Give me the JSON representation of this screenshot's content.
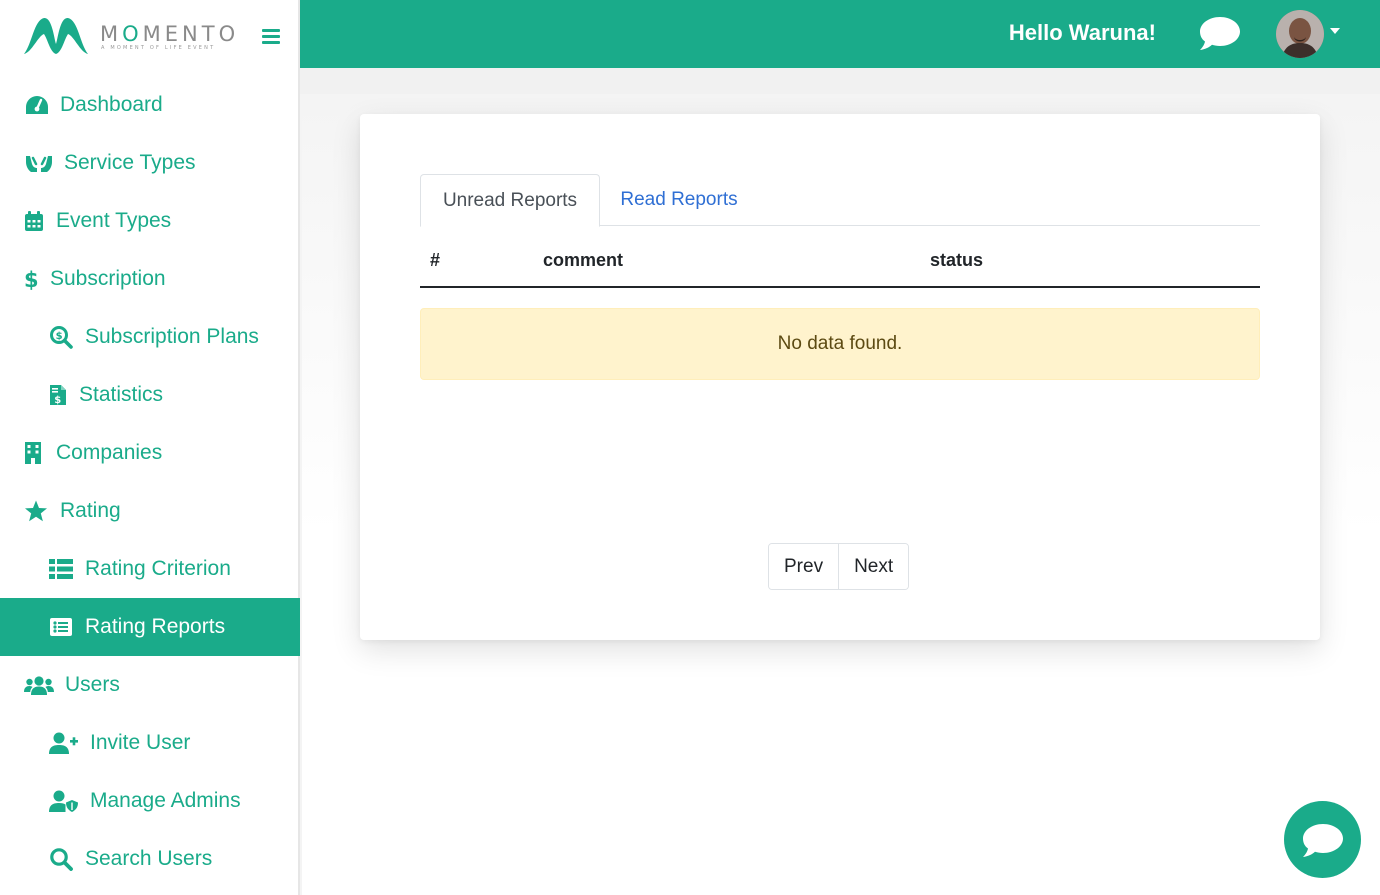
{
  "brand": {
    "name_prefix": "M",
    "name_o": "O",
    "name_suffix": "MENTO",
    "tagline": "A MOMENT OF LIFE EVENT"
  },
  "header": {
    "greeting": "Hello Waruna!"
  },
  "sidebar": {
    "items": [
      {
        "label": "Dashboard",
        "icon": "dashboard-gauge-icon"
      },
      {
        "label": "Service Types",
        "icon": "hands-icon"
      },
      {
        "label": "Event Types",
        "icon": "calendar-icon"
      },
      {
        "label": "Subscription",
        "icon": "dollar-icon"
      },
      {
        "label": "Subscription Plans",
        "icon": "search-dollar-icon"
      },
      {
        "label": "Statistics",
        "icon": "invoice-dollar-icon"
      },
      {
        "label": "Companies",
        "icon": "building-icon"
      },
      {
        "label": "Rating",
        "icon": "star-icon"
      },
      {
        "label": "Rating Criterion",
        "icon": "list-icon"
      },
      {
        "label": "Rating Reports",
        "icon": "list-alt-icon"
      },
      {
        "label": "Users",
        "icon": "users-icon"
      },
      {
        "label": "Invite User",
        "icon": "user-plus-icon"
      },
      {
        "label": "Manage Admins",
        "icon": "user-shield-icon"
      },
      {
        "label": "Search Users",
        "icon": "search-icon"
      }
    ],
    "active": "Rating Reports"
  },
  "tabs": [
    {
      "label": "Unread Reports",
      "active": true
    },
    {
      "label": "Read Reports",
      "active": false
    }
  ],
  "table": {
    "columns": [
      "#",
      "comment",
      "status"
    ],
    "empty_message": "No data found."
  },
  "pagination": {
    "prev_label": "Prev",
    "next_label": "Next"
  },
  "colors": {
    "accent": "#1aab8a",
    "link": "#2f6fd4",
    "alert_bg": "#fff3cd"
  }
}
